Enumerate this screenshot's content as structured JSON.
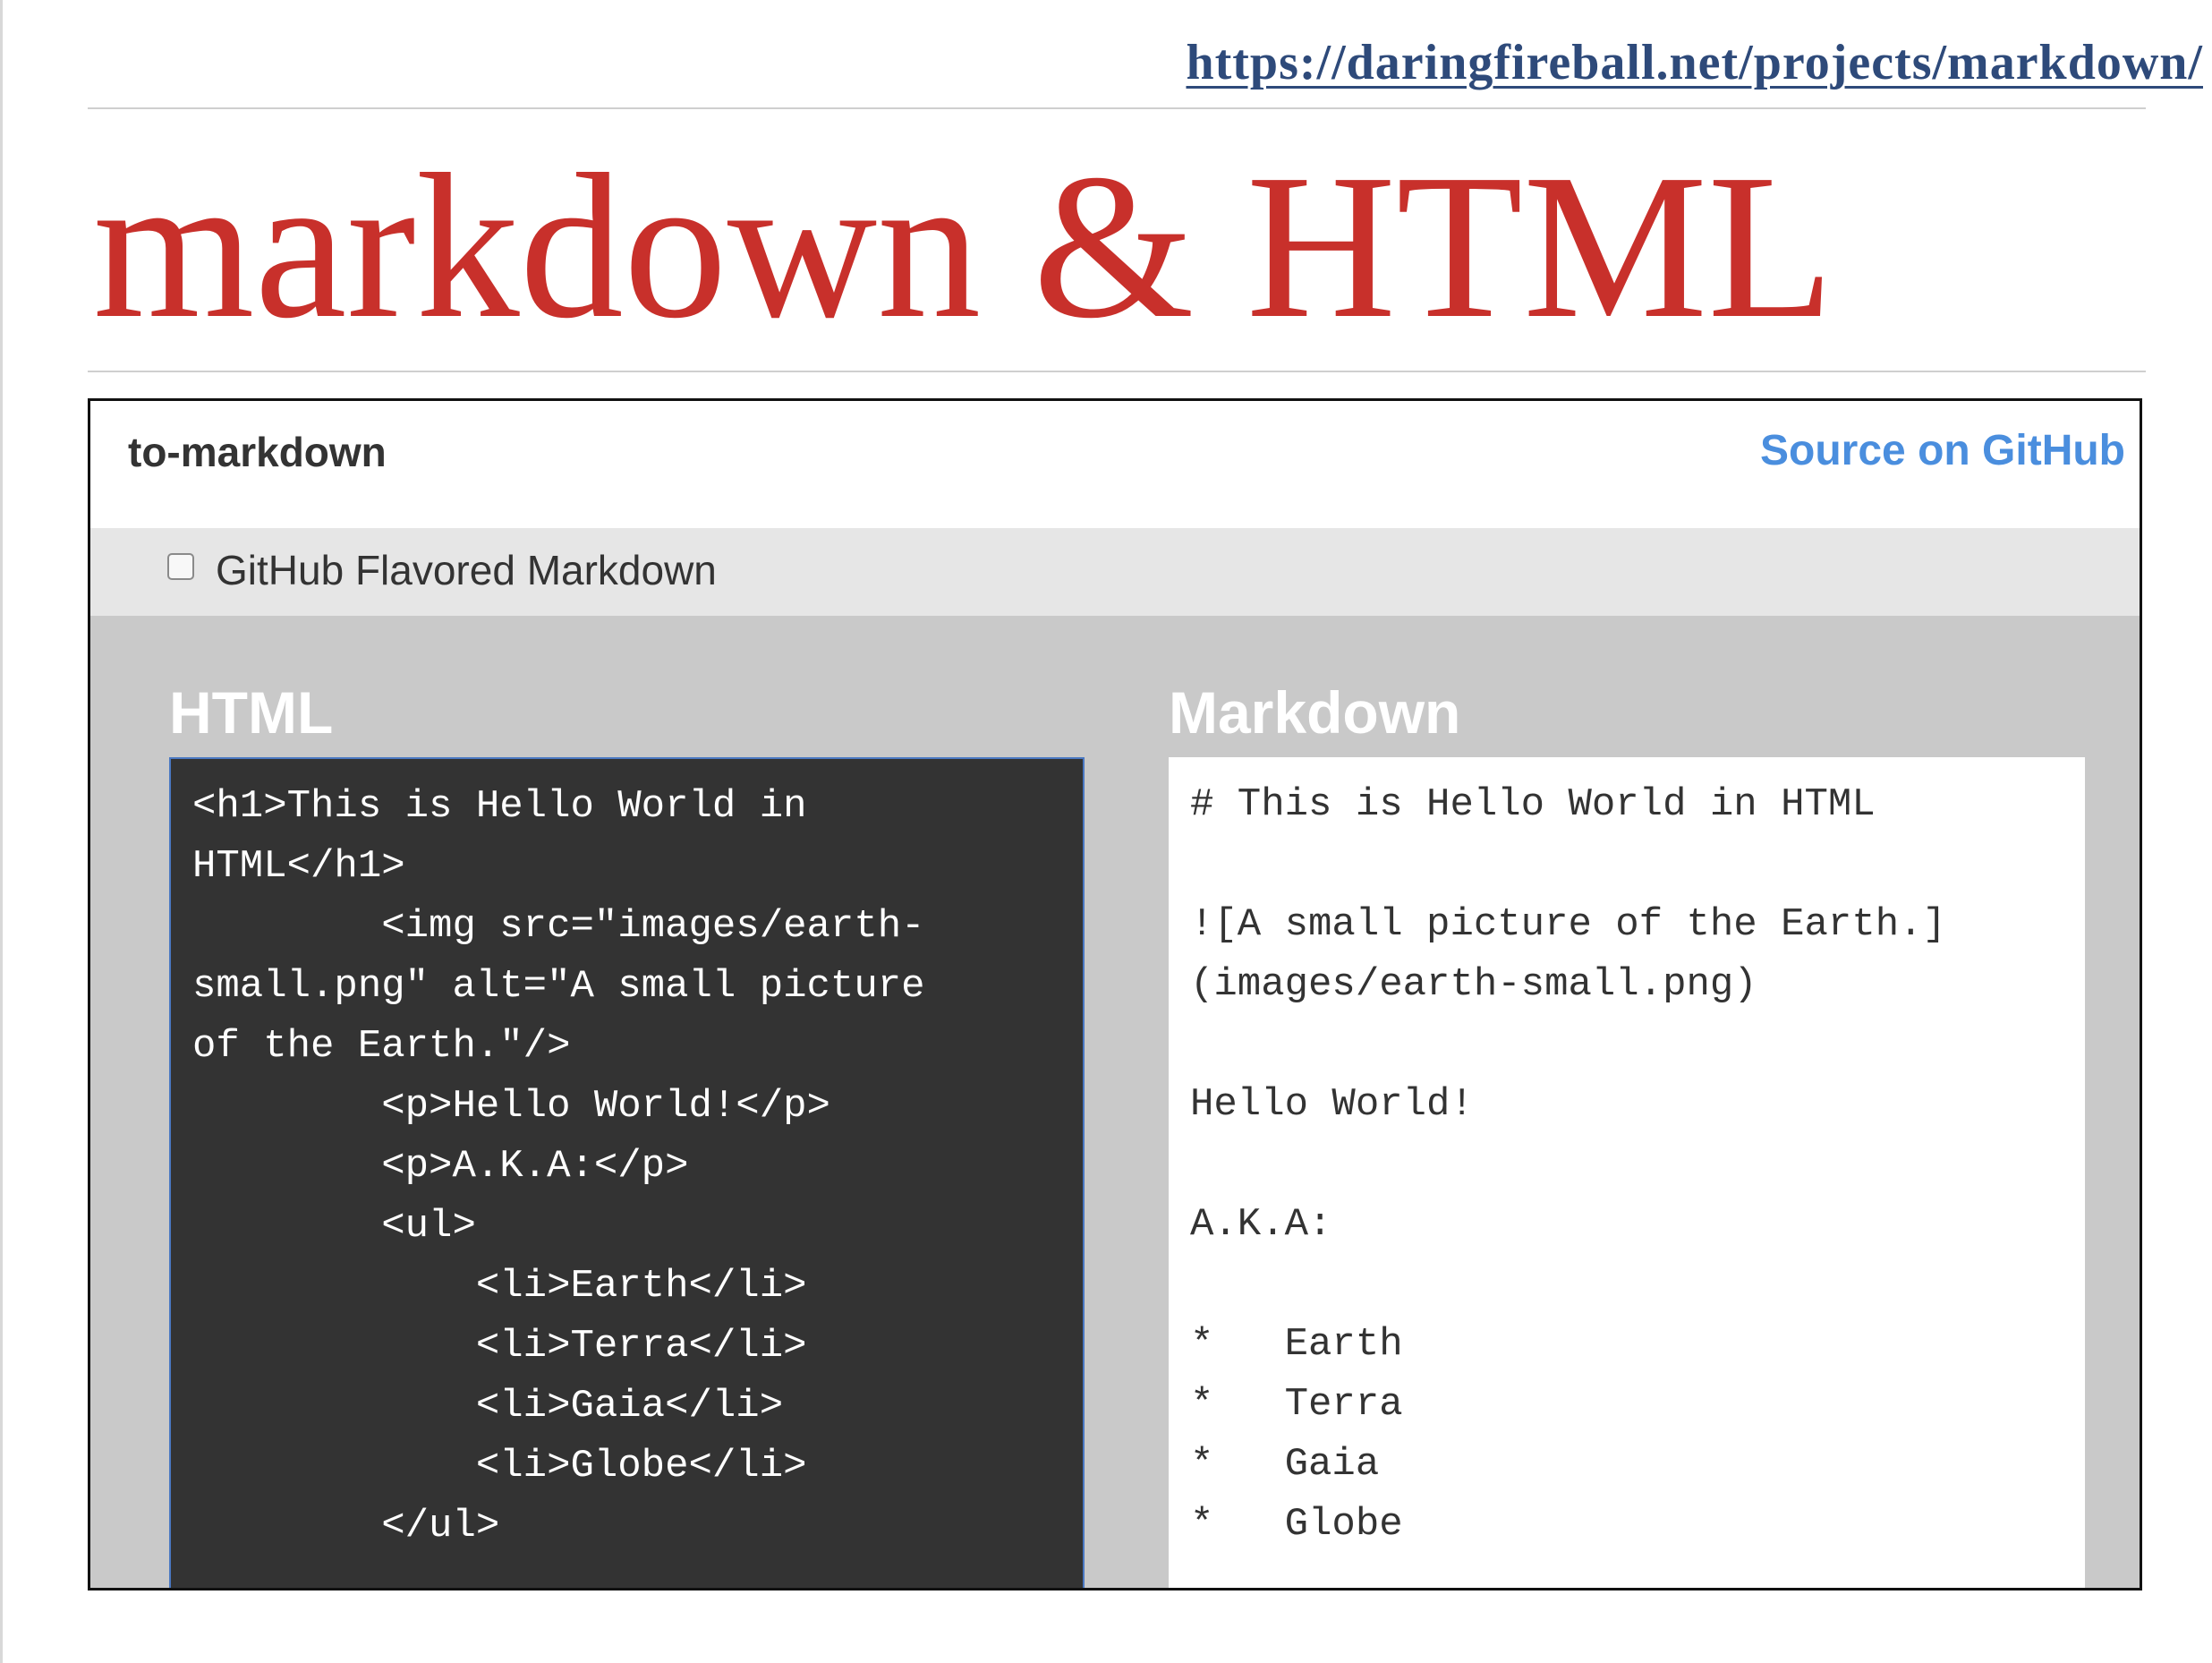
{
  "slide": {
    "url": "https://daringfireball.net/projects/markdown/",
    "title": "markdown & HTML"
  },
  "app": {
    "name": "to-markdown",
    "source_link": "Source on GitHub",
    "option_label": "GitHub Flavored Markdown",
    "option_checked": false,
    "html_panel_title": "HTML",
    "markdown_panel_title": "Markdown",
    "html_input": "<h1>This is Hello World in\nHTML</h1>\n        <img src=\"images/earth-\nsmall.png\" alt=\"A small picture\nof the Earth.\"/>\n        <p>Hello World!</p>\n        <p>A.K.A:</p>\n        <ul>\n            <li>Earth</li>\n            <li>Terra</li>\n            <li>Gaia</li>\n            <li>Globe</li>\n        </ul>",
    "markdown_output": "# This is Hello World in HTML\n\n![A small picture of the Earth.]\n(images/earth-small.png)\n\nHello World!\n\nA.K.A:\n\n*   Earth\n*   Terra\n*   Gaia\n*   Globe"
  },
  "colors": {
    "title": "#c8302b",
    "url": "#2e4a7a",
    "link": "#4a8ede",
    "editor_bg": "#333333",
    "app_bg": "#c9c9c9"
  }
}
